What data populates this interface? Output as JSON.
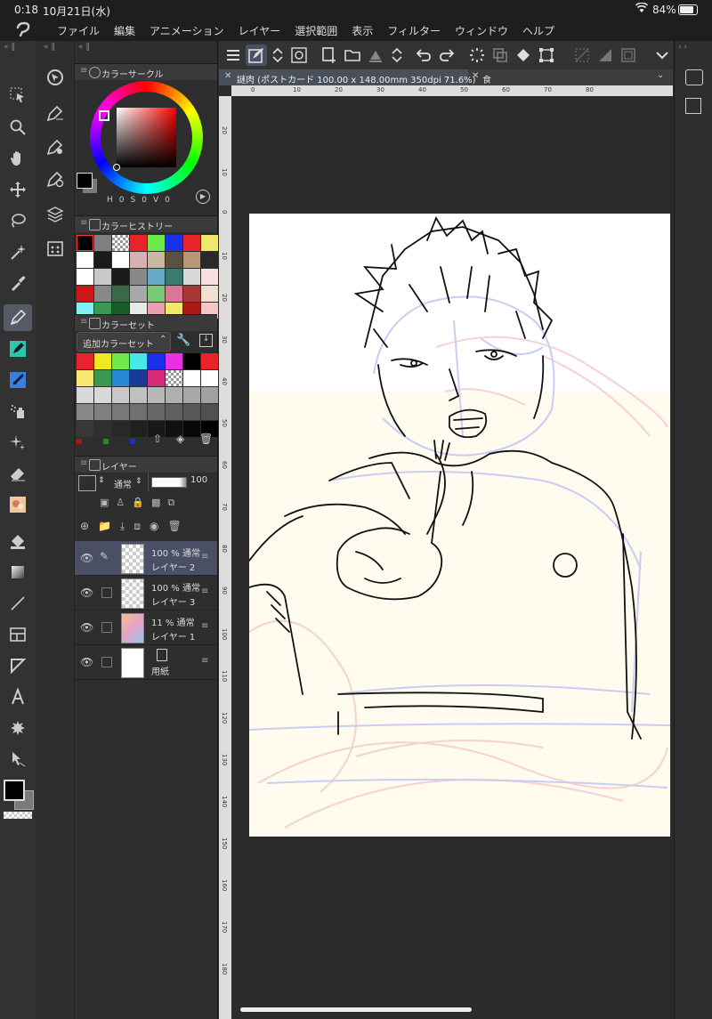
{
  "status_bar": {
    "time": "0:18",
    "date": "10月21日(水)",
    "battery": "84%"
  },
  "menu_bar": {
    "items": [
      "ファイル",
      "編集",
      "アニメーション",
      "レイヤー",
      "選択範囲",
      "表示",
      "フィルター",
      "ウィンドウ",
      "ヘルプ"
    ]
  },
  "color_circle": {
    "title": "カラーサークル",
    "hsv_labels": [
      "H",
      "0",
      "S",
      "0",
      "V",
      "0"
    ]
  },
  "color_history": {
    "title": "カラーヒストリー",
    "colors": [
      "#000000",
      "#7f7f7f",
      "checker",
      "#e8242a",
      "#6ee84a",
      "#1830e8",
      "#e8242a",
      "#f0e868",
      "#ffffff",
      "#1a1a1a",
      "#ffffff",
      "#d8b0b0",
      "#c8b8a0",
      "#5c5040",
      "#b89878",
      "#2a2a2a",
      "#ffffff",
      "#c8c8c8",
      "#1a1a1a",
      "#888888",
      "#6aa8c8",
      "#3a7a70",
      "#d8d8d8",
      "#f8e0e0",
      "#c81818",
      "#888888",
      "#3a6848",
      "#a8a8a8",
      "#78c878",
      "#d87898",
      "#a83838",
      "#f0e0d0",
      "#80f0f0",
      "#3a9850",
      "#1a5a28",
      "#e8e8e8",
      "#e8a0b0",
      "#f0e868",
      "#a81818",
      "#f0c8c8"
    ]
  },
  "color_set": {
    "title": "カラーセット",
    "dropdown_value": "追加カラーセット",
    "colors": [
      "#e8242a",
      "#f0e820",
      "#6ee84a",
      "#48e8e8",
      "#1830e8",
      "#e830e8",
      "#000000",
      "#e8242a",
      "#f8e870",
      "#3a9850",
      "#2888d8",
      "#1a3898",
      "#d82878",
      "checker",
      "#ffffff",
      "#ffffff",
      "#d8d8d8",
      "#d8d8d8",
      "#c8c8c8",
      "#c0c0c0",
      "#b8b8b8",
      "#b0b0b0",
      "#a8a8a8",
      "#a0a0a0",
      "#888888",
      "#808080",
      "#787878",
      "#707070",
      "#686868",
      "#606060",
      "#585858",
      "#505050",
      "#383838",
      "#303030",
      "#282828",
      "#202020",
      "#181818",
      "#101010",
      "#080808",
      "#000000"
    ]
  },
  "layer_panel": {
    "title": "レイヤー",
    "blend_mode": "通常",
    "opacity": "100",
    "layers": [
      {
        "pct": "100 % 通常",
        "name": "レイヤー 2",
        "selected": true,
        "thumb": "checker",
        "pen": true
      },
      {
        "pct": "100 % 通常",
        "name": "レイヤー 3",
        "selected": false,
        "thumb": "checker",
        "pen": false
      },
      {
        "pct": "11 % 通常",
        "name": "レイヤー 1",
        "selected": false,
        "thumb": "img",
        "pen": false
      },
      {
        "pct": "",
        "name": "用紙",
        "selected": false,
        "thumb": "white",
        "pen": false
      }
    ]
  },
  "tabs": {
    "active": "謎肉 (ポストカード 100.00 x 148.00mm 350dpi 71.6%)",
    "second": "食"
  },
  "rulers": {
    "h": [
      "0",
      "10",
      "20",
      "30",
      "40",
      "50",
      "60",
      "70",
      "80"
    ],
    "v": [
      "20",
      "10",
      "0",
      "10",
      "20",
      "30",
      "40",
      "50",
      "60",
      "70",
      "80",
      "90",
      "100",
      "110",
      "120",
      "130",
      "140",
      "150",
      "160",
      "170",
      "180"
    ]
  },
  "colors": {
    "accent": "#4a4f66",
    "main_color": "#000000",
    "sub_color": "#7a7a7a"
  }
}
